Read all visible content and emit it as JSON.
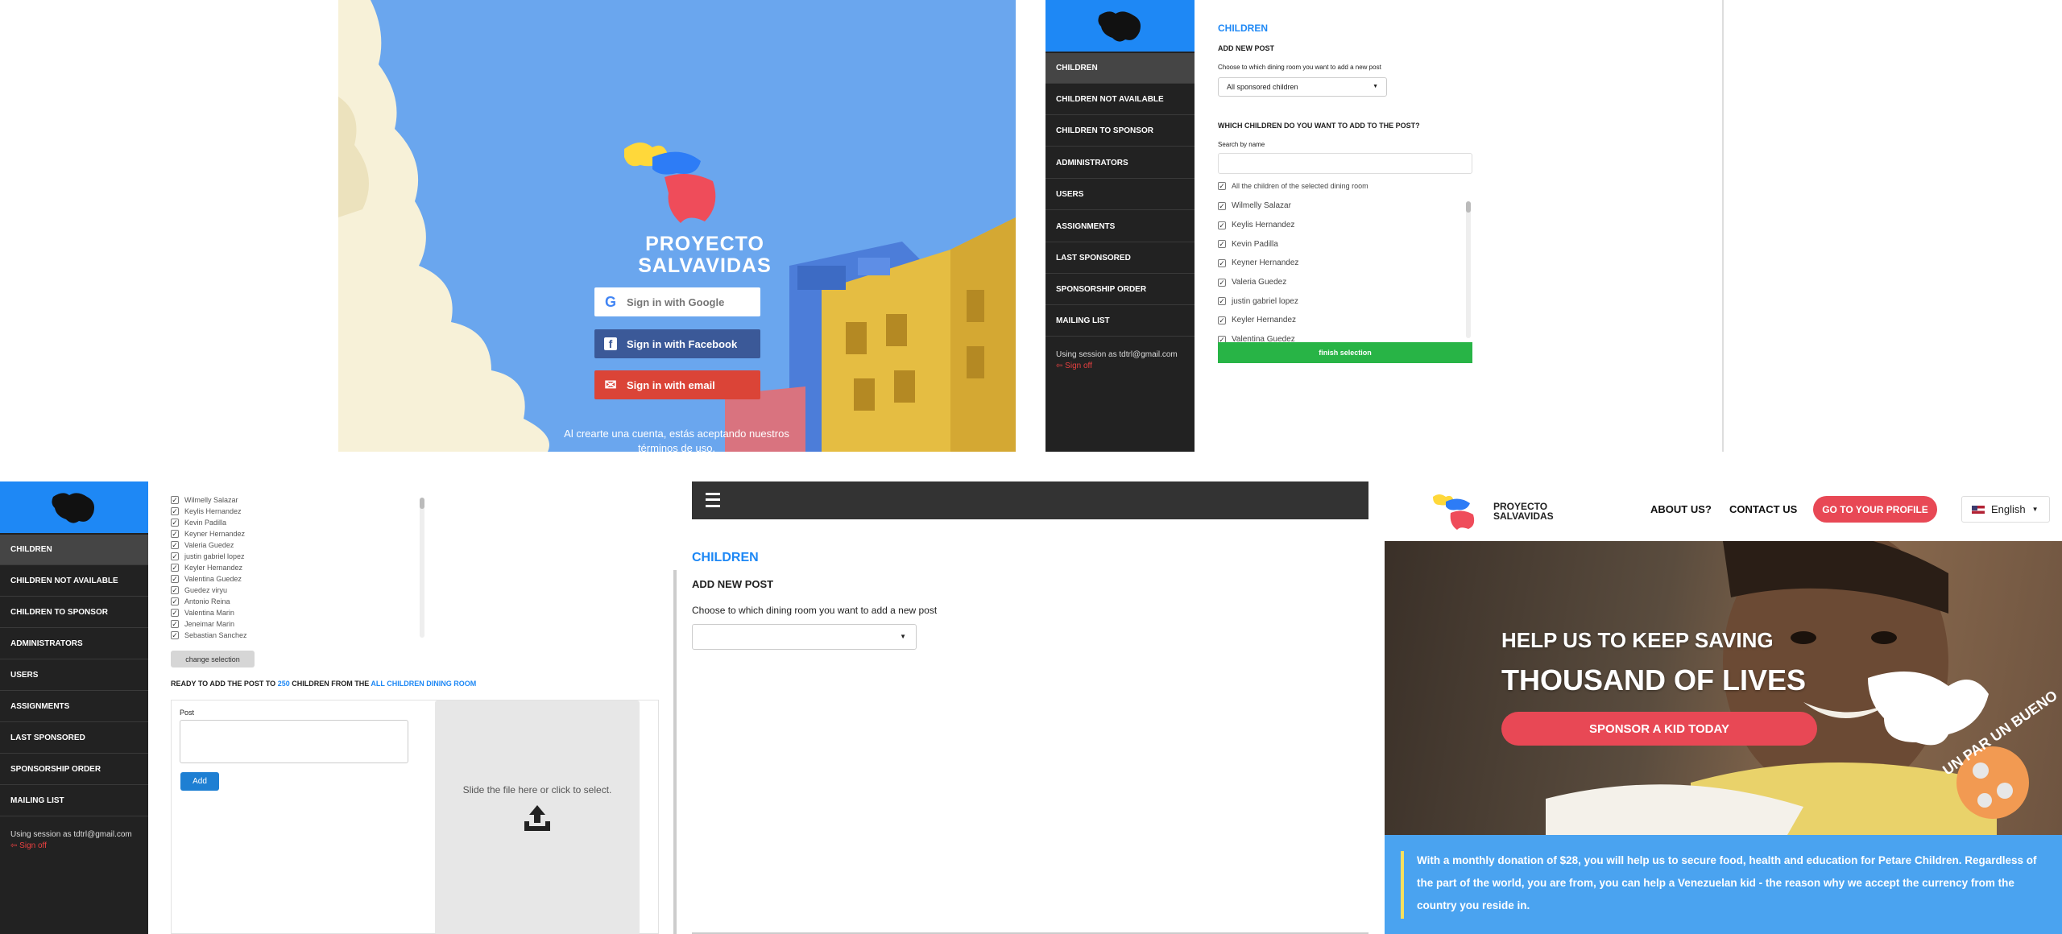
{
  "signin": {
    "brand_line1": "PROYECTO",
    "brand_line2": "SALVAVIDAS",
    "google_label": "Sign in with Google",
    "facebook_label": "Sign in with Facebook",
    "email_label": "Sign in with email",
    "terms_line1": "Al crearte una cuenta, estás aceptando nuestros",
    "terms_line2": "términos de uso.",
    "colors": {
      "sky": "#6aa6ee",
      "google": "#ffffff",
      "facebook": "#3b5998",
      "email": "#db4437"
    }
  },
  "sidebar": {
    "items": [
      {
        "label": "CHILDREN",
        "active": true
      },
      {
        "label": "CHILDREN NOT AVAILABLE"
      },
      {
        "label": "CHILDREN TO SPONSOR"
      },
      {
        "label": "ADMINISTRATORS"
      },
      {
        "label": "USERS"
      },
      {
        "label": "ASSIGNMENTS"
      },
      {
        "label": "LAST SPONSORED"
      },
      {
        "label": "SPONSORSHIP ORDER"
      },
      {
        "label": "MAILING LIST"
      }
    ],
    "session_text": "Using session as tdtrl@gmail.com",
    "sign_off": "Sign off",
    "accent": "#1e88f5"
  },
  "post_form": {
    "section_title": "CHILDREN",
    "add_title": "ADD NEW POST",
    "dining_prompt": "Choose to which dining room you want to add a new post",
    "dining_selected": "All sponsored children",
    "which_children": "WHICH CHILDREN DO YOU WANT TO ADD TO THE POST?",
    "search_label": "Search by name",
    "search_value": "",
    "all_children_label": "All the children of the selected dining room",
    "finish_button": "finish selection",
    "children": [
      "Wilmelly Salazar",
      "Keylis Hernandez",
      "Kevin Padilla",
      "Keyner Hernandez",
      "Valeria Guedez",
      "justin gabriel lopez",
      "Keyler Hernandez",
      "Valentina Guedez"
    ]
  },
  "post_ready": {
    "children": [
      "Wilmelly Salazar",
      "Keylis Hernandez",
      "Kevin Padilla",
      "Keyner Hernandez",
      "Valeria Guedez",
      "justin gabriel lopez",
      "Keyler Hernandez",
      "Valentina Guedez",
      "Guedez viryu",
      "Antonio Reina",
      "Valentina Marin",
      "Jeneimar Marin",
      "Sebastian Sanchez"
    ],
    "change_button": "change selection",
    "ready_prefix": "READY TO ADD THE POST TO ",
    "ready_count": "250",
    "ready_middle": " CHILDREN FROM THE ",
    "ready_room": "ALL CHILDREN DINING ROOM",
    "post_label": "Post",
    "post_value": "",
    "add_button": "Add",
    "upload_text": "Slide the file here or click to select.",
    "upload_icon": "upload-icon"
  },
  "mobile_post": {
    "menu_icon": "hamburger-icon",
    "section_title": "CHILDREN",
    "add_title": "ADD NEW POST",
    "dining_prompt": "Choose to which dining room you want to add a new post",
    "dining_selected": ""
  },
  "landing": {
    "brand_line1": "PROYECTO",
    "brand_line2": "SALVAVIDAS",
    "nav_about": "ABOUT US?",
    "nav_contact": "CONTACT US",
    "profile_button": "GO TO YOUR PROFILE",
    "language": "English",
    "hero_line1": "HELP US TO KEEP SAVING",
    "hero_line2": "THOUSAND OF LIVES",
    "sponsor_button": "SPONSOR A KID TODAY",
    "ball_text": "UN PAR UN BUENO",
    "donation_text": "With a monthly donation of $28, you will help us to secure food, health and education for Petare Children. Regardless of the part of the world, you are from, you can help a Venezuelan kid - the reason why we accept the currency from the country you reside in.",
    "colors": {
      "red": "#e84855",
      "blue": "#4aa3f0",
      "stripe": "#f6e05e"
    }
  }
}
